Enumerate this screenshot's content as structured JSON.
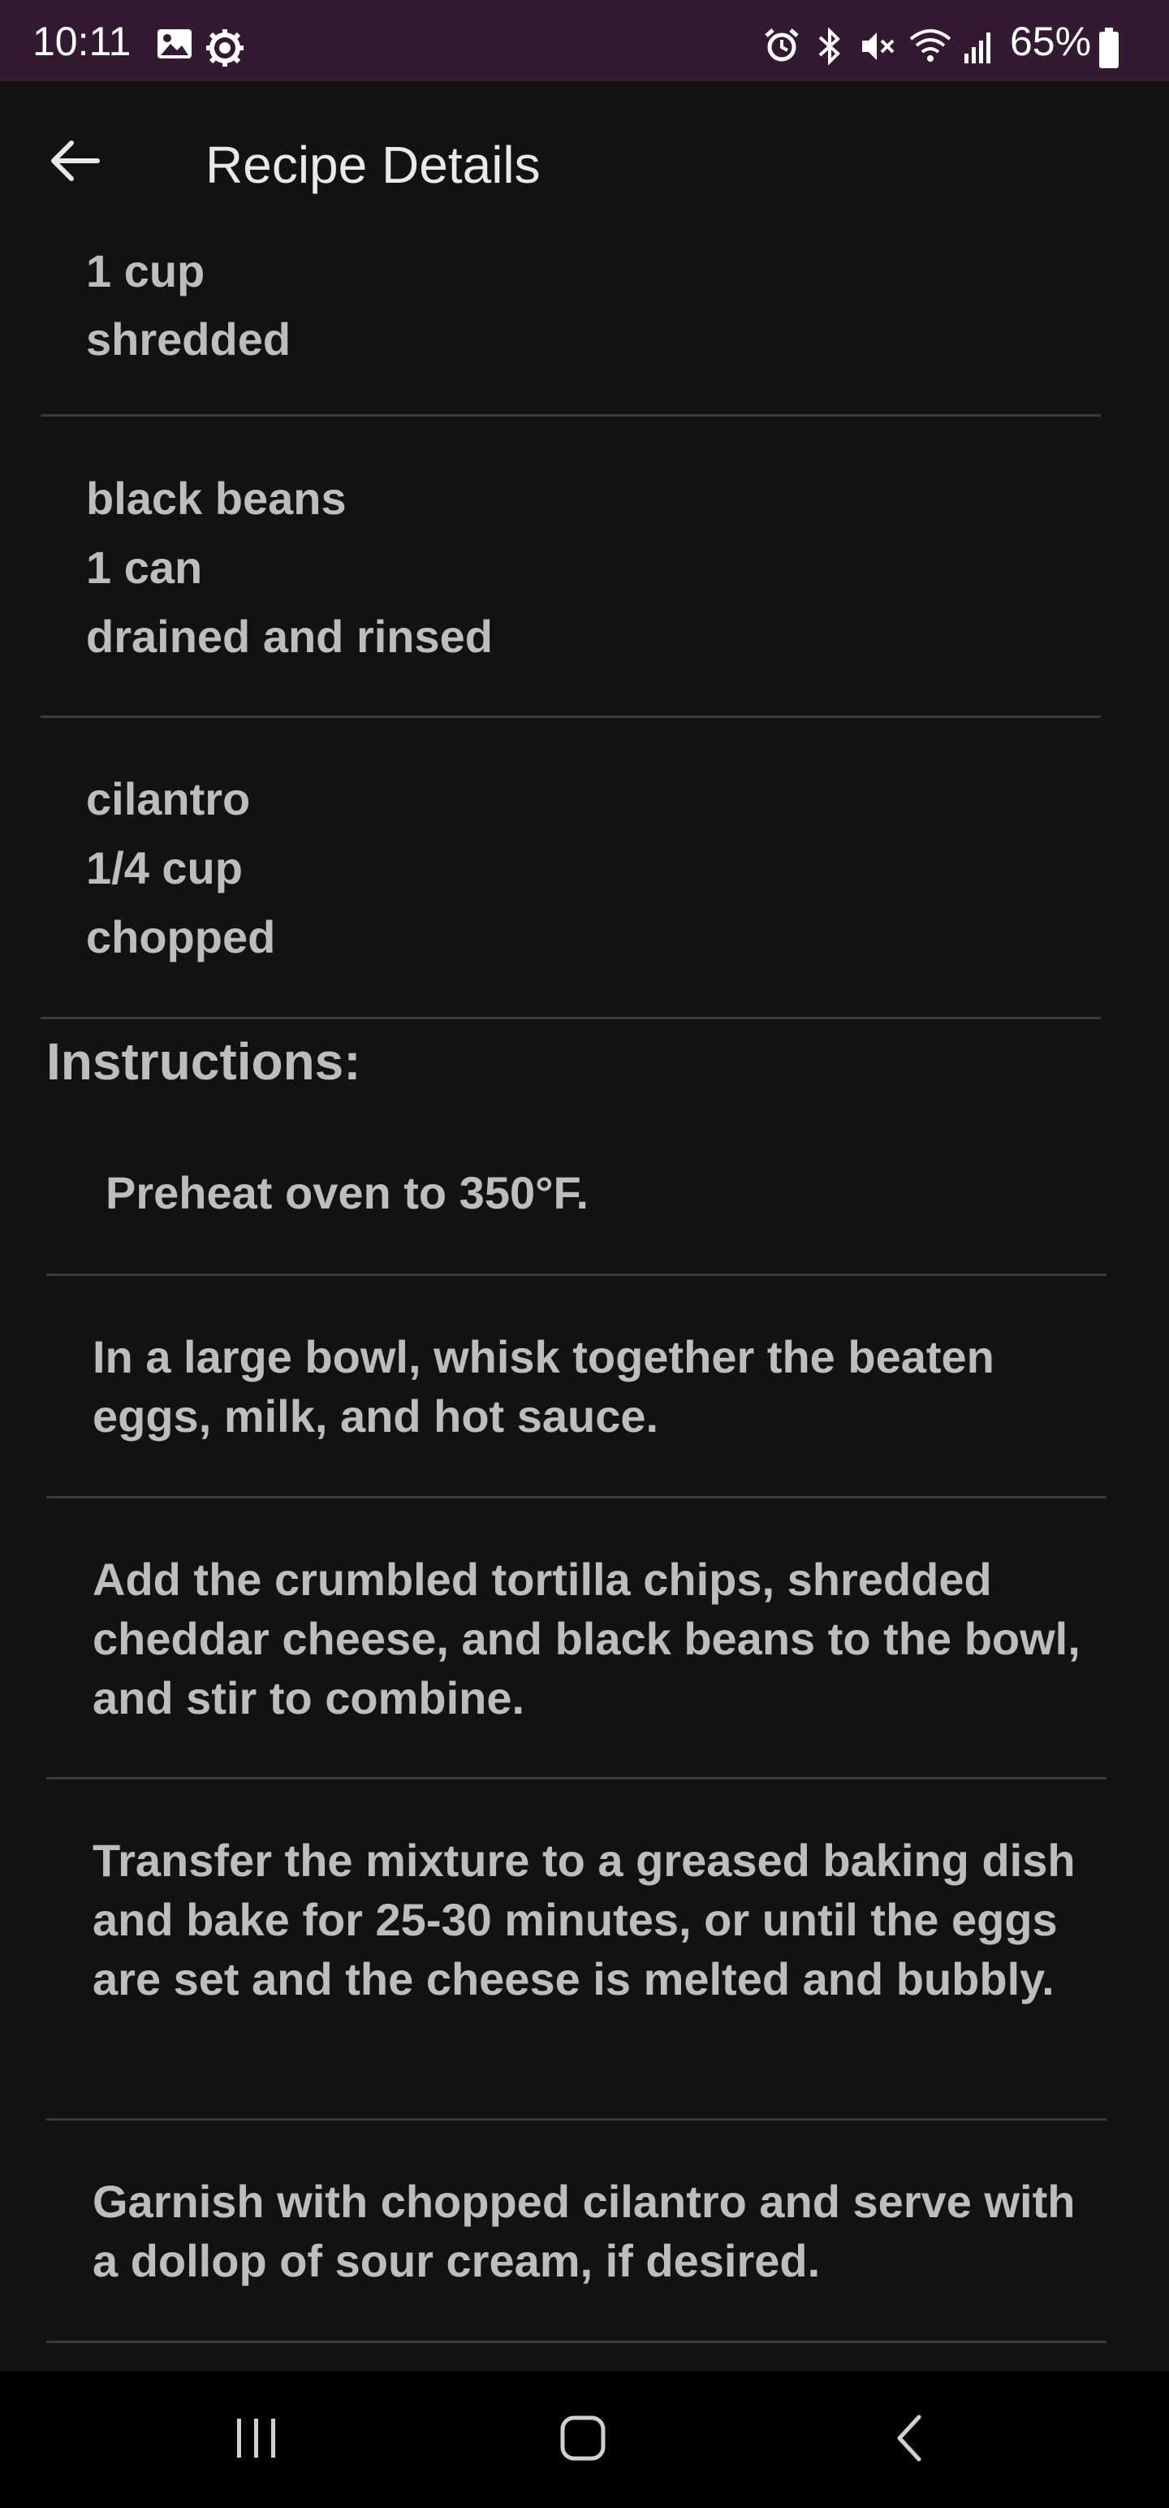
{
  "status_bar": {
    "time": "10:11",
    "battery_percent": "65%",
    "icons": [
      "image-icon",
      "settings-icon",
      "alarm-icon",
      "bluetooth-icon",
      "mute-icon",
      "wifi-icon",
      "signal-icon",
      "battery-icon"
    ]
  },
  "app_bar": {
    "title": "Recipe Details"
  },
  "ingredients": [
    {
      "lines": [
        "1 cup",
        "shredded"
      ]
    },
    {
      "lines": [
        "black beans",
        "1 can",
        "drained and rinsed"
      ]
    },
    {
      "lines": [
        "cilantro",
        "1/4 cup",
        "chopped"
      ]
    }
  ],
  "instructions": {
    "heading": "Instructions:",
    "steps": [
      "Preheat oven to 350°F.",
      "In a large bowl, whisk together the beaten eggs, milk, and hot sauce.",
      "Add the crumbled tortilla chips, shredded cheddar cheese, and black beans to the bowl, and stir to combine.",
      "Transfer the mixture to a greased baking dish and bake for 25-30 minutes, or until the eggs are set and the cheese is melted and bubbly.",
      "Garnish with chopped cilantro and serve with a dollop of sour cream, if desired."
    ]
  },
  "nav_bar": {
    "icons": [
      "recent-apps-icon",
      "home-icon",
      "back-icon"
    ]
  },
  "colors": {
    "status_bar_bg": "#321a31",
    "background": "#121212",
    "text": "#bdbdbd",
    "divider": "#3a3a3a"
  }
}
